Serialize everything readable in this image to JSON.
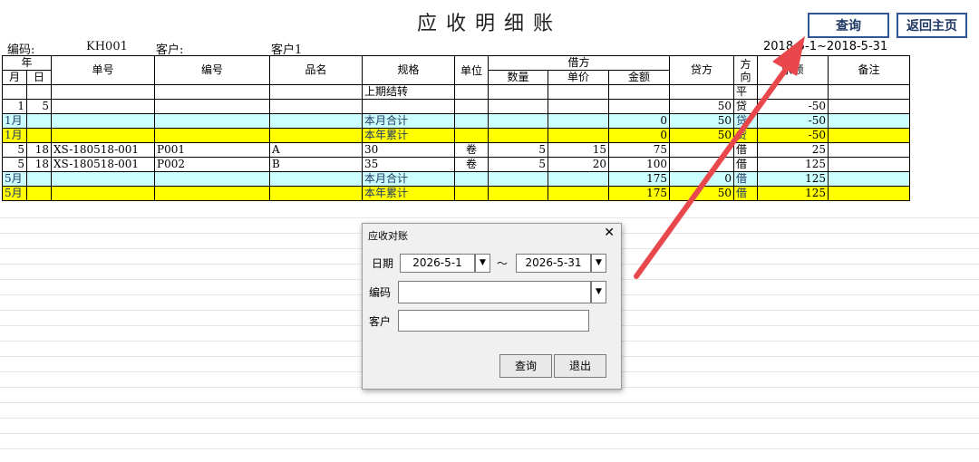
{
  "sheet": {
    "title": "应收明细账",
    "code_label": "编码:",
    "code_value": "KH001",
    "customer_label": "客户:",
    "customer_value": "客户1",
    "date_range": "2018-5-1~2018-5-31"
  },
  "buttons": {
    "query": "查询",
    "home": "返回主页"
  },
  "table": {
    "headers": {
      "year": "年",
      "month": "月",
      "day": "日",
      "order_no": "单号",
      "code": "编号",
      "product": "品名",
      "spec": "规格",
      "unit": "单位",
      "debit": "借方",
      "qty": "数量",
      "price": "单价",
      "amount": "金额",
      "credit": "贷方",
      "direction": "方向",
      "balance": "余额",
      "note": "备注"
    },
    "rows": [
      {
        "m": "",
        "d": "",
        "order": "",
        "code": "",
        "product": "",
        "spec": "上期结转",
        "unit": "",
        "qty": "",
        "price": "",
        "amount": "",
        "credit": "",
        "dir": "平",
        "bal": "",
        "note": "",
        "style": "plain"
      },
      {
        "m": "1",
        "d": "5",
        "order": "",
        "code": "",
        "product": "",
        "spec": "",
        "unit": "",
        "qty": "",
        "price": "",
        "amount": "",
        "credit": "50",
        "dir": "贷",
        "bal": "-50",
        "note": "",
        "style": "plain"
      },
      {
        "m": "1月",
        "d": "",
        "order": "",
        "code": "",
        "product": "",
        "spec": "本月合计",
        "unit": "",
        "qty": "",
        "price": "",
        "amount": "0",
        "credit": "50",
        "dir": "贷",
        "bal": "-50",
        "note": "",
        "style": "cyan"
      },
      {
        "m": "1月",
        "d": "",
        "order": "",
        "code": "",
        "product": "",
        "spec": "本年累计",
        "unit": "",
        "qty": "",
        "price": "",
        "amount": "0",
        "credit": "50",
        "dir": "贷",
        "bal": "-50",
        "note": "",
        "style": "yel"
      },
      {
        "m": "5",
        "d": "18",
        "order": "XS-180518-001",
        "code": "P001",
        "product": "A",
        "spec": "30",
        "unit": "卷",
        "qty": "5",
        "price": "15",
        "amount": "75",
        "credit": "",
        "dir": "借",
        "bal": "25",
        "note": "",
        "style": "plain"
      },
      {
        "m": "5",
        "d": "18",
        "order": "XS-180518-001",
        "code": "P002",
        "product": "B",
        "spec": "35",
        "unit": "卷",
        "qty": "5",
        "price": "20",
        "amount": "100",
        "credit": "",
        "dir": "借",
        "bal": "125",
        "note": "",
        "style": "plain"
      },
      {
        "m": "5月",
        "d": "",
        "order": "",
        "code": "",
        "product": "",
        "spec": "本月合计",
        "unit": "",
        "qty": "",
        "price": "",
        "amount": "175",
        "credit": "0",
        "dir": "借",
        "bal": "125",
        "note": "",
        "style": "cyan"
      },
      {
        "m": "5月",
        "d": "",
        "order": "",
        "code": "",
        "product": "",
        "spec": "本年累计",
        "unit": "",
        "qty": "",
        "price": "",
        "amount": "175",
        "credit": "50",
        "dir": "借",
        "bal": "125",
        "note": "",
        "style": "yel"
      }
    ]
  },
  "dialog": {
    "title": "应收对账",
    "close": "✕",
    "date_label": "日期",
    "date_from": "2026-5-1",
    "tilde": "～",
    "date_to": "2026-5-31",
    "code_label": "编码",
    "code_value": "",
    "customer_label": "客户",
    "customer_value": "",
    "dropdown_glyph": "▼",
    "query_button": "查询",
    "exit_button": "退出"
  },
  "colors": {
    "arrow": "#e8474c",
    "button_border": "#2f5597",
    "cyan_row": "#ccffff",
    "yellow_row": "#ffff00"
  }
}
